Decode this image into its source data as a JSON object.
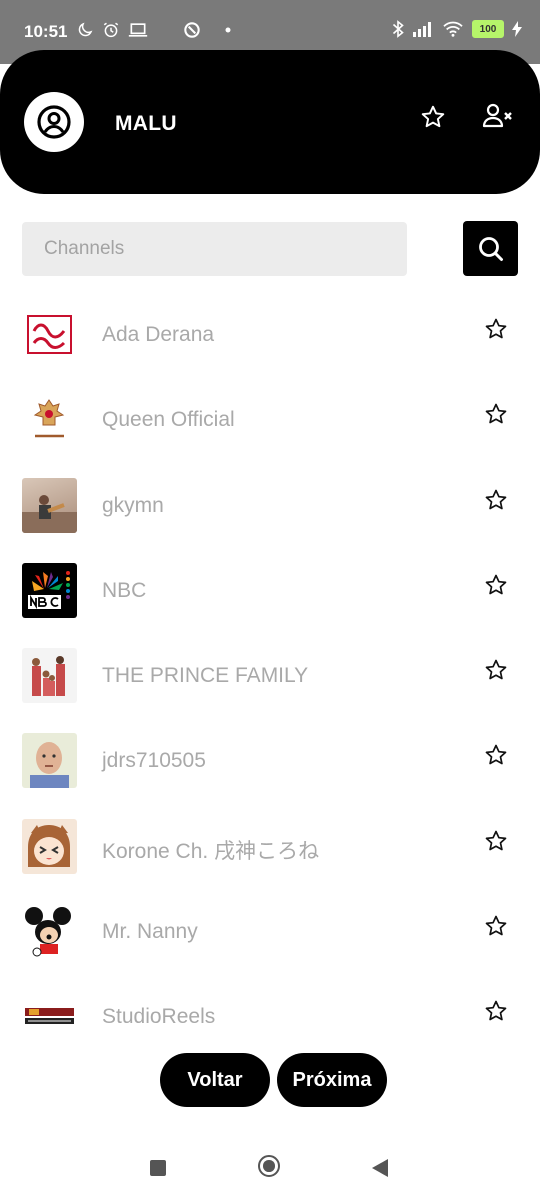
{
  "status_bar": {
    "time": "10:51",
    "battery": "100",
    "left_icons": [
      "moon-icon",
      "alarm-icon",
      "laptop-icon",
      "sync-icon",
      "dot-icon"
    ],
    "right_icons": [
      "bluetooth-icon",
      "signal-icon",
      "wifi-icon",
      "battery-icon",
      "charging-icon"
    ]
  },
  "header": {
    "username": "MALU",
    "icons": [
      "user-circle-icon",
      "star-outline-icon",
      "user-remove-icon"
    ]
  },
  "search": {
    "placeholder": "Channels",
    "button_icon": "search-icon"
  },
  "channels": [
    {
      "name": "Ada Derana"
    },
    {
      "name": "Queen Official"
    },
    {
      "name": "gkymn"
    },
    {
      "name": "NBC"
    },
    {
      "name": "THE PRINCE FAMILY"
    },
    {
      "name": "jdrs710505"
    },
    {
      "name": "Korone Ch. 戌神ころね"
    },
    {
      "name": "Mr. Nanny"
    },
    {
      "name": "StudioReels"
    }
  ],
  "pagination": {
    "back_label": "Voltar",
    "next_label": "Próxima"
  },
  "colors": {
    "header_bg": "#000000",
    "status_bar_bg": "#7a7a7a",
    "channel_text": "#a9a9a9",
    "search_bg": "#ececec",
    "battery": "#b6f56a"
  }
}
